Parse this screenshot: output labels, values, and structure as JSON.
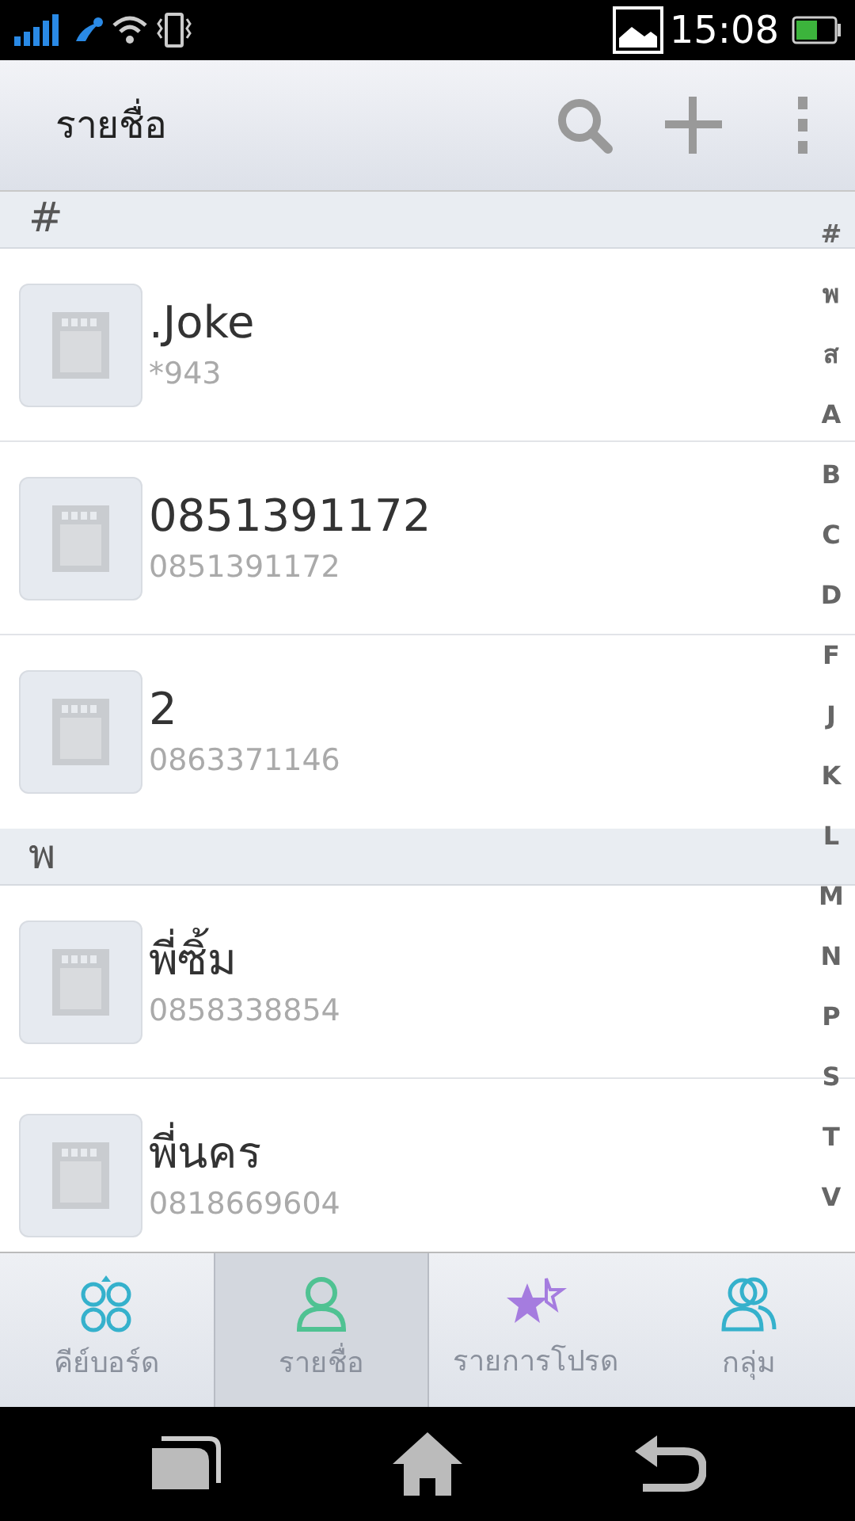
{
  "status_bar": {
    "time": "15:08"
  },
  "header": {
    "title": "รายชื่อ"
  },
  "sections": [
    {
      "letter": "#",
      "contacts": [
        {
          "name": ".Joke",
          "number": "*943"
        },
        {
          "name": "0851391172",
          "number": "0851391172"
        },
        {
          "name": "2",
          "number": "0863371146"
        }
      ]
    },
    {
      "letter": "พ",
      "contacts": [
        {
          "name": "พี่ซิ้ม",
          "number": "0858338854"
        },
        {
          "name": "พี่นคร",
          "number": "0818669604"
        }
      ]
    }
  ],
  "index": [
    "#",
    "พ",
    "ส",
    "A",
    "B",
    "C",
    "D",
    "F",
    "J",
    "K",
    "L",
    "M",
    "N",
    "P",
    "S",
    "T",
    "V"
  ],
  "tabs": [
    {
      "label": "คีย์บอร์ด",
      "kind": "keypad",
      "selected": false
    },
    {
      "label": "รายชื่อ",
      "kind": "contacts",
      "selected": true
    },
    {
      "label": "รายการโปรด",
      "kind": "favorites",
      "selected": false
    },
    {
      "label": "กลุ่ม",
      "kind": "groups",
      "selected": false
    }
  ]
}
